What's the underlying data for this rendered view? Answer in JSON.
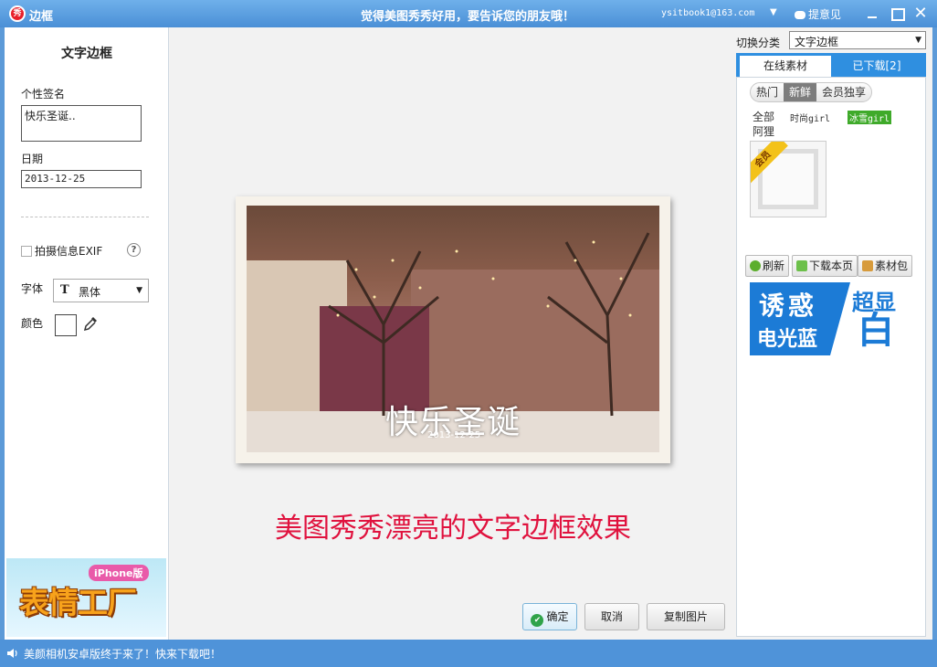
{
  "titlebar": {
    "logo_char": "秀",
    "title": "边框",
    "slogan": "觉得美图秀秀好用，要告诉您的朋友哦！",
    "account": "ysitbook1@163.com",
    "feedback": "提意见"
  },
  "left_panel": {
    "title": "文字边框",
    "signature_label": "个性签名",
    "signature_value": "快乐圣诞..",
    "date_label": "日期",
    "date_value": "2013-12-25",
    "exif_label": "拍摄信息EXIF",
    "help": "?",
    "font_label": "字体",
    "font_value": "黑体",
    "color_label": "颜色",
    "promo_badge": "iPhone版",
    "promo_text": "表情工厂"
  },
  "canvas": {
    "overlay_text": "快乐圣诞",
    "overlay_date": "2013-12-25",
    "caption": "美图秀秀漂亮的文字边框效果",
    "ok": "确定",
    "cancel": "取消",
    "copy": "复制图片"
  },
  "right_panel": {
    "category_label": "切换分类",
    "category_value": "文字边框",
    "tab_online": "在线素材",
    "tab_downloaded": "已下载[2]",
    "pills": [
      "热门",
      "新鲜",
      "会员独享"
    ],
    "subcats": [
      "全部",
      "时尚girl",
      "冰雪girl",
      "阿狸"
    ],
    "vip": "会员",
    "refresh": "刷新",
    "download_page": "下载本页",
    "material_pack": "素材包",
    "banner_l1": "诱惑",
    "banner_l2": "电光蓝",
    "banner_r1": "超显",
    "banner_r2": "白"
  },
  "statusbar": {
    "text": "美颜相机安卓版终于来了！快来下载吧！"
  },
  "colors": {
    "accent": "#2f8fe0",
    "caption": "#e0123e",
    "active_subcat": "#3faa2a"
  }
}
